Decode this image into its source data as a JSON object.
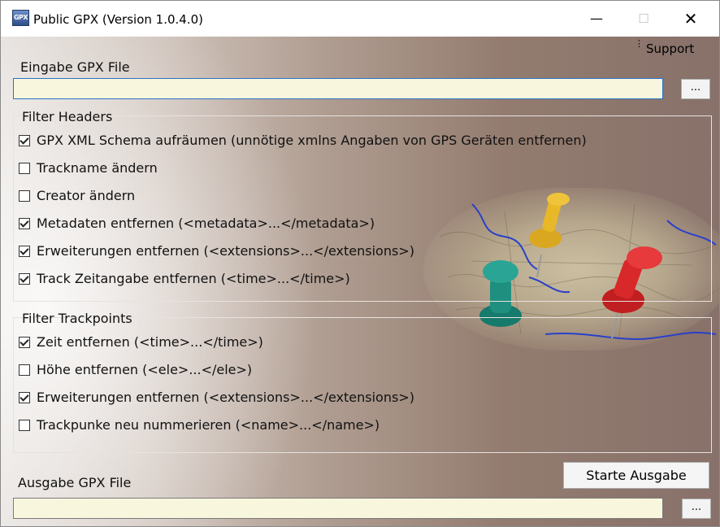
{
  "window": {
    "title": "Public GPX (Version 1.0.4.0)",
    "icon_text": "GPX",
    "icon": "gpx-app-icon",
    "minimize_glyph": "—",
    "maximize_glyph": "☐",
    "close_glyph": "✕"
  },
  "menu": {
    "dots": "⋮",
    "support_label": "Support"
  },
  "input": {
    "label": "Eingabe GPX File",
    "value": "",
    "browse_label": "..."
  },
  "headers": {
    "title": "Filter Headers",
    "options": [
      {
        "label": "GPX XML Schema aufräumen (unnötige xmlns Angaben von GPS Geräten entfernen)",
        "checked": true
      },
      {
        "label": "Trackname ändern",
        "checked": false
      },
      {
        "label": "Creator ändern",
        "checked": false
      },
      {
        "label": "Metadaten entfernen (<metadata>...</metadata>)",
        "checked": true
      },
      {
        "label": "Erweiterungen entfernen (<extensions>...</extensions>)",
        "checked": true
      },
      {
        "label": "Track Zeitangabe entfernen (<time>...</time>)",
        "checked": true
      }
    ]
  },
  "trackpoints": {
    "title": "Filter Trackpoints",
    "options": [
      {
        "label": "Zeit entfernen (<time>...</time>)",
        "checked": true
      },
      {
        "label": "Höhe entfernen (<ele>...</ele>)",
        "checked": false
      },
      {
        "label": "Erweiterungen entfernen (<extensions>...</extensions>)",
        "checked": true
      },
      {
        "label": "Trackpunke neu nummerieren (<name>...</name>)",
        "checked": false
      }
    ]
  },
  "output": {
    "label": "Ausgabe GPX File",
    "value": "",
    "browse_label": "...",
    "start_label": "Starte Ausgabe"
  },
  "colors": {
    "field_bg": "#f8f6dc",
    "pin_yellow": "#e8b828",
    "pin_teal": "#1f8f7f",
    "pin_red": "#d8282a",
    "map_river": "#2a40c8"
  }
}
